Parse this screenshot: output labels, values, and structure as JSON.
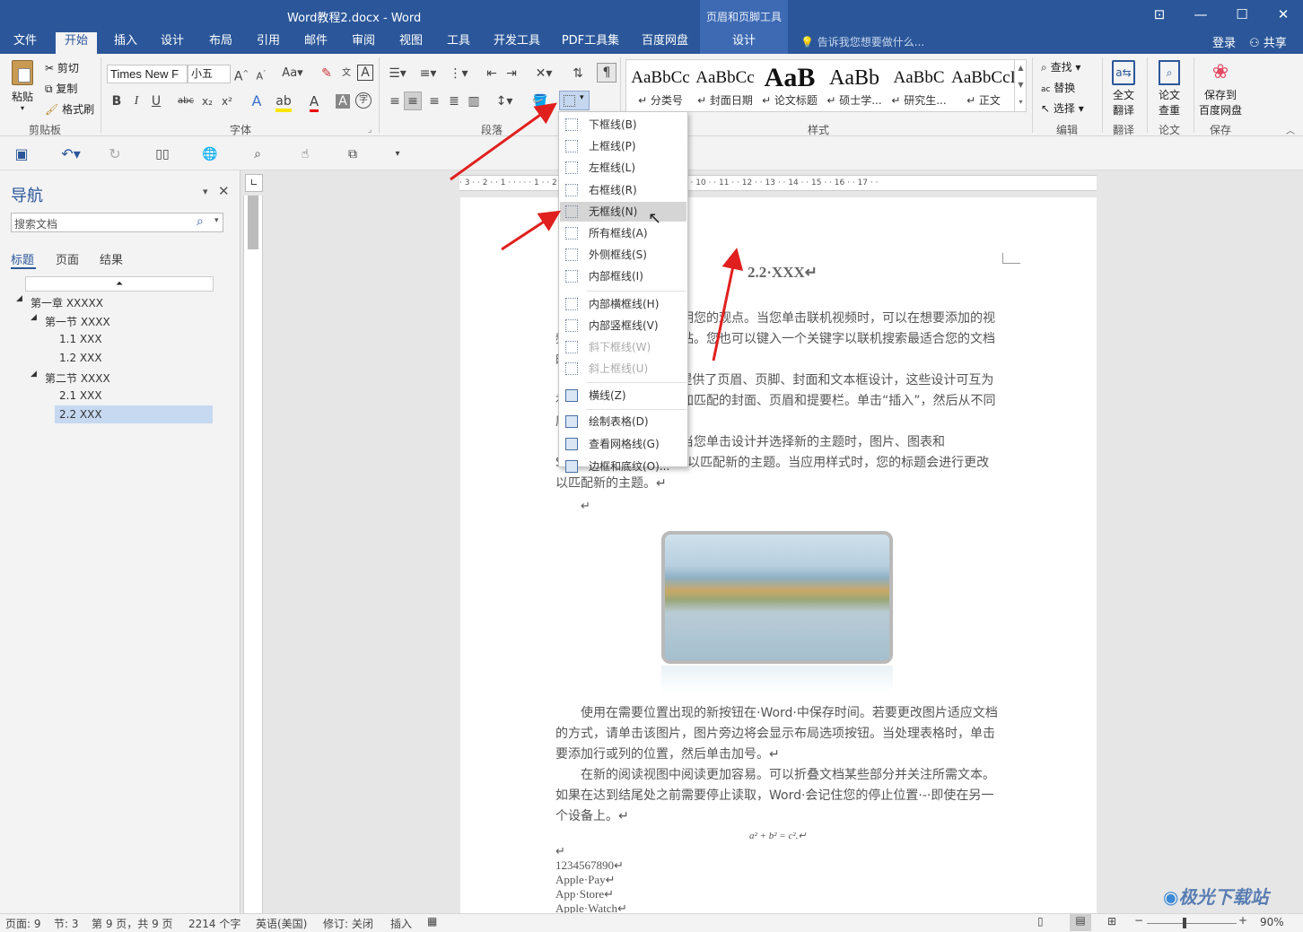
{
  "app": {
    "title": "Word教程2.docx - Word",
    "context_group": "页眉和页脚工具",
    "context_tab": "设计",
    "tell_me": "告诉我您想要做什么...",
    "login": "登录",
    "share": "共享"
  },
  "tabs": [
    "文件",
    "开始",
    "插入",
    "设计",
    "布局",
    "引用",
    "邮件",
    "审阅",
    "视图",
    "工具",
    "开发工具",
    "PDF工具集",
    "百度网盘"
  ],
  "active_tab": "开始",
  "ribbon": {
    "clipboard": {
      "paste": "粘贴",
      "cut": "剪切",
      "copy": "复制",
      "format_painter": "格式刷",
      "group": "剪贴板"
    },
    "font": {
      "name": "Times New F",
      "size": "小五",
      "group": "字体"
    },
    "paragraph": {
      "group": "段落"
    },
    "styles": {
      "group": "样式",
      "items": [
        {
          "preview": "AaBbCc",
          "name": "↵ 分类号"
        },
        {
          "preview": "AaBbCc",
          "name": "↵ 封面日期"
        },
        {
          "preview": "AaB",
          "name": "↵ 论文标题"
        },
        {
          "preview": "AaBb",
          "name": "↵ 硕士学..."
        },
        {
          "preview": "AaBbC",
          "name": "↵ 研究生..."
        },
        {
          "preview": "AaBbCcI",
          "name": "↵ 正文"
        }
      ]
    },
    "editing": {
      "find": "查找",
      "replace": "替换",
      "select": "选择",
      "group": "编辑"
    },
    "translate": {
      "label1": "全文",
      "label2": "翻译",
      "group": "翻译"
    },
    "paper": {
      "label1": "论文",
      "label2": "查重",
      "group": "论文"
    },
    "save": {
      "label1": "保存到",
      "label2": "百度网盘",
      "group": "保存"
    }
  },
  "navigation": {
    "title": "导航",
    "search_placeholder": "搜索文档",
    "tabs": [
      "标题",
      "页面",
      "结果"
    ],
    "tree": [
      {
        "label": "第一章 XXXXX",
        "level": 0,
        "expanded": true
      },
      {
        "label": "第一节 XXXX",
        "level": 1,
        "expanded": true
      },
      {
        "label": "1.1 XXX",
        "level": 2
      },
      {
        "label": "1.2 XXX",
        "level": 2
      },
      {
        "label": "第二节 XXXX",
        "level": 1,
        "expanded": true
      },
      {
        "label": "2.1 XXX",
        "level": 2
      },
      {
        "label": "2.2 XXX",
        "level": 2,
        "selected": true
      }
    ]
  },
  "border_menu": {
    "items": [
      {
        "label": "下框线(B)",
        "state": "normal"
      },
      {
        "label": "上框线(P)",
        "state": "normal"
      },
      {
        "label": "左框线(L)",
        "state": "normal"
      },
      {
        "label": "右框线(R)",
        "state": "normal"
      },
      {
        "label": "无框线(N)",
        "state": "highlighted"
      },
      {
        "label": "所有框线(A)",
        "state": "normal"
      },
      {
        "label": "外侧框线(S)",
        "state": "normal"
      },
      {
        "label": "内部框线(I)",
        "state": "normal"
      },
      {
        "label": "内部横框线(H)",
        "state": "normal"
      },
      {
        "label": "内部竖框线(V)",
        "state": "normal"
      },
      {
        "label": "斜下框线(W)",
        "state": "disabled"
      },
      {
        "label": "斜上框线(U)",
        "state": "disabled"
      },
      {
        "label": "横线(Z)",
        "state": "normal"
      },
      {
        "label": "绘制表格(D)",
        "state": "normal"
      },
      {
        "label": "查看网格线(G)",
        "state": "normal"
      },
      {
        "label": "边框和底纹(O)...",
        "state": "normal"
      }
    ]
  },
  "document": {
    "heading": "2.2·XXX↵",
    "p1": "大的方法帮助您证明您的观点。当您单击联机视频时，可以在想要添加的视频的嵌入代码中进行粘贴。您也可以键入一个关键字以联机搜索最适合您的文档的视频。↵",
    "p2": "专业外观，Word·提供了页眉、页脚、封面和文本框设计，这些设计可互为补充。例如，您可以添加匹配的封面、页眉和提要栏。单击“插入”，然后从不同库中选择所需元素。↵",
    "p3": "于文档保持协调。当您单击设计并选择新的主题时，图片、图表和SmartArt图形将会更改以匹配新的主题。当应用样式时，您的标题会进行更改以匹配新的主题。↵",
    "p4": "使用在需要位置出现的新按钮在·Word·中保存时间。若要更改图片适应文档的方式，请单击该图片，图片旁边将会显示布局选项按钮。当处理表格时，单击要添加行或列的位置，然后单击加号。↵",
    "p5": "在新的阅读视图中阅读更加容易。可以折叠文档某些部分并关注所需文本。如果在达到结尾处之前需要停止读取，Word·会记住您的停止位置·-·即使在另一个设备上。↵",
    "formula": "a² + b² = c².↵",
    "lines": [
      "↵",
      "1234567890↵",
      "Apple·Pay↵",
      "App·Store↵",
      "Apple·Watch↵"
    ]
  },
  "status": {
    "page": "页面: 9",
    "section": "节: 3",
    "pages": "第 9 页，共 9 页",
    "words": "2214 个字",
    "language": "英语(美国)",
    "track": "修订: 关闭",
    "insert": "插入",
    "zoom": "90%"
  },
  "watermark": "极光下载站",
  "colors": {
    "accent": "#2b579a",
    "arrow": "#e0201e",
    "highlight": "#d5d5d5"
  }
}
